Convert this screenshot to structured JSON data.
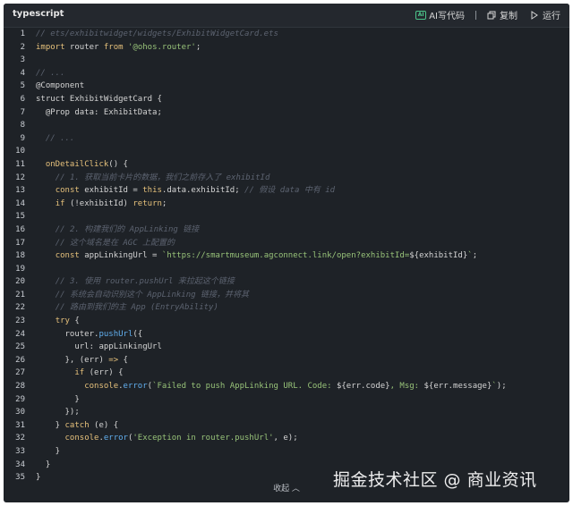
{
  "header": {
    "language": "typescript",
    "ai_label": "AI写代码",
    "copy_label": "复制",
    "run_label": "运行"
  },
  "code_lines": [
    {
      "n": "1",
      "segs": [
        {
          "t": "// ets/exhibitwidget/widgets/ExhibitWidgetCard.ets",
          "c": "c-com"
        }
      ]
    },
    {
      "n": "2",
      "segs": [
        {
          "t": "import",
          "c": "c-kw"
        },
        {
          "t": " router ",
          "c": "c-var"
        },
        {
          "t": "from",
          "c": "c-kw"
        },
        {
          "t": " ",
          "c": "c-var"
        },
        {
          "t": "'@ohos.router'",
          "c": "c-str"
        },
        {
          "t": ";",
          "c": "c-var"
        }
      ]
    },
    {
      "n": "3",
      "segs": []
    },
    {
      "n": "4",
      "segs": [
        {
          "t": "// ...",
          "c": "c-com"
        }
      ]
    },
    {
      "n": "5",
      "segs": [
        {
          "t": "@Component",
          "c": "c-dec"
        }
      ]
    },
    {
      "n": "6",
      "segs": [
        {
          "t": "struct ExhibitWidgetCard {",
          "c": "c-var"
        }
      ]
    },
    {
      "n": "7",
      "segs": [
        {
          "t": "  @Prop data: ExhibitData;",
          "c": "c-var"
        }
      ]
    },
    {
      "n": "8",
      "segs": []
    },
    {
      "n": "9",
      "segs": [
        {
          "t": "  ",
          "c": "c-var"
        },
        {
          "t": "// ...",
          "c": "c-com"
        }
      ]
    },
    {
      "n": "10",
      "segs": []
    },
    {
      "n": "11",
      "segs": [
        {
          "t": "  ",
          "c": "c-var"
        },
        {
          "t": "onDetailClick",
          "c": "c-kw"
        },
        {
          "t": "() {",
          "c": "c-var"
        }
      ]
    },
    {
      "n": "12",
      "segs": [
        {
          "t": "    ",
          "c": "c-var"
        },
        {
          "t": "// 1. 获取当前卡片的数据，我们之前存入了 exhibitId",
          "c": "c-com"
        }
      ]
    },
    {
      "n": "13",
      "segs": [
        {
          "t": "    ",
          "c": "c-var"
        },
        {
          "t": "const",
          "c": "c-kw"
        },
        {
          "t": " exhibitId = ",
          "c": "c-var"
        },
        {
          "t": "this",
          "c": "c-this"
        },
        {
          "t": ".data.exhibitId; ",
          "c": "c-var"
        },
        {
          "t": "// 假设 data 中有 id",
          "c": "c-com"
        }
      ]
    },
    {
      "n": "14",
      "segs": [
        {
          "t": "    ",
          "c": "c-var"
        },
        {
          "t": "if",
          "c": "c-kw"
        },
        {
          "t": " (!exhibitId) ",
          "c": "c-var"
        },
        {
          "t": "return",
          "c": "c-kw"
        },
        {
          "t": ";",
          "c": "c-var"
        }
      ]
    },
    {
      "n": "15",
      "segs": []
    },
    {
      "n": "16",
      "segs": [
        {
          "t": "    ",
          "c": "c-var"
        },
        {
          "t": "// 2. 构建我们的 AppLinking 链接",
          "c": "c-com"
        }
      ]
    },
    {
      "n": "17",
      "segs": [
        {
          "t": "    ",
          "c": "c-var"
        },
        {
          "t": "// 这个域名是在 AGC 上配置的",
          "c": "c-com"
        }
      ]
    },
    {
      "n": "18",
      "segs": [
        {
          "t": "    ",
          "c": "c-var"
        },
        {
          "t": "const",
          "c": "c-kw"
        },
        {
          "t": " appLinkingUrl = ",
          "c": "c-var"
        },
        {
          "t": "`https://smartmuseum.agconnect.link/open?exhibitId=",
          "c": "c-str"
        },
        {
          "t": "${exhibitId}",
          "c": "c-var"
        },
        {
          "t": "`",
          "c": "c-str"
        },
        {
          "t": ";",
          "c": "c-var"
        }
      ]
    },
    {
      "n": "19",
      "segs": []
    },
    {
      "n": "20",
      "segs": [
        {
          "t": "    ",
          "c": "c-var"
        },
        {
          "t": "// 3. 使用 router.pushUrl 来拉起这个链接",
          "c": "c-com"
        }
      ]
    },
    {
      "n": "21",
      "segs": [
        {
          "t": "    ",
          "c": "c-var"
        },
        {
          "t": "// 系统会自动识别这个 AppLinking 链接，并将其",
          "c": "c-com"
        }
      ]
    },
    {
      "n": "22",
      "segs": [
        {
          "t": "    ",
          "c": "c-var"
        },
        {
          "t": "// 路由到我们的主 App (EntryAbility)",
          "c": "c-com"
        }
      ]
    },
    {
      "n": "23",
      "segs": [
        {
          "t": "    ",
          "c": "c-var"
        },
        {
          "t": "try",
          "c": "c-kw"
        },
        {
          "t": " {",
          "c": "c-var"
        }
      ]
    },
    {
      "n": "24",
      "segs": [
        {
          "t": "      router.",
          "c": "c-var"
        },
        {
          "t": "pushUrl",
          "c": "c-fn"
        },
        {
          "t": "({",
          "c": "c-var"
        }
      ]
    },
    {
      "n": "25",
      "segs": [
        {
          "t": "        url: appLinkingUrl",
          "c": "c-var"
        }
      ]
    },
    {
      "n": "26",
      "segs": [
        {
          "t": "      }, (err) ",
          "c": "c-var"
        },
        {
          "t": "=>",
          "c": "c-kw"
        },
        {
          "t": " {",
          "c": "c-var"
        }
      ]
    },
    {
      "n": "27",
      "segs": [
        {
          "t": "        ",
          "c": "c-var"
        },
        {
          "t": "if",
          "c": "c-kw"
        },
        {
          "t": " (err) {",
          "c": "c-var"
        }
      ]
    },
    {
      "n": "28",
      "segs": [
        {
          "t": "          ",
          "c": "c-var"
        },
        {
          "t": "console",
          "c": "c-kw"
        },
        {
          "t": ".",
          "c": "c-var"
        },
        {
          "t": "error",
          "c": "c-fn"
        },
        {
          "t": "(",
          "c": "c-var"
        },
        {
          "t": "`Failed to push AppLinking URL. Code: ",
          "c": "c-str"
        },
        {
          "t": "${err.code}",
          "c": "c-var"
        },
        {
          "t": ", Msg: ",
          "c": "c-str"
        },
        {
          "t": "${err.message}",
          "c": "c-var"
        },
        {
          "t": "`",
          "c": "c-str"
        },
        {
          "t": ");",
          "c": "c-var"
        }
      ]
    },
    {
      "n": "29",
      "segs": [
        {
          "t": "        }",
          "c": "c-var"
        }
      ]
    },
    {
      "n": "30",
      "segs": [
        {
          "t": "      });",
          "c": "c-var"
        }
      ]
    },
    {
      "n": "31",
      "segs": [
        {
          "t": "    } ",
          "c": "c-var"
        },
        {
          "t": "catch",
          "c": "c-kw"
        },
        {
          "t": " (e) {",
          "c": "c-var"
        }
      ]
    },
    {
      "n": "32",
      "segs": [
        {
          "t": "      ",
          "c": "c-var"
        },
        {
          "t": "console",
          "c": "c-kw"
        },
        {
          "t": ".",
          "c": "c-var"
        },
        {
          "t": "error",
          "c": "c-fn"
        },
        {
          "t": "(",
          "c": "c-var"
        },
        {
          "t": "'Exception in router.pushUrl'",
          "c": "c-str"
        },
        {
          "t": ", e);",
          "c": "c-var"
        }
      ]
    },
    {
      "n": "33",
      "segs": [
        {
          "t": "    }",
          "c": "c-var"
        }
      ]
    },
    {
      "n": "34",
      "segs": [
        {
          "t": "  }",
          "c": "c-var"
        }
      ]
    },
    {
      "n": "35",
      "segs": [
        {
          "t": "}",
          "c": "c-var"
        }
      ]
    }
  ],
  "footer": {
    "collapse_label": "收起 ︿"
  },
  "watermark": "掘金技术社区 @ 商业资讯"
}
